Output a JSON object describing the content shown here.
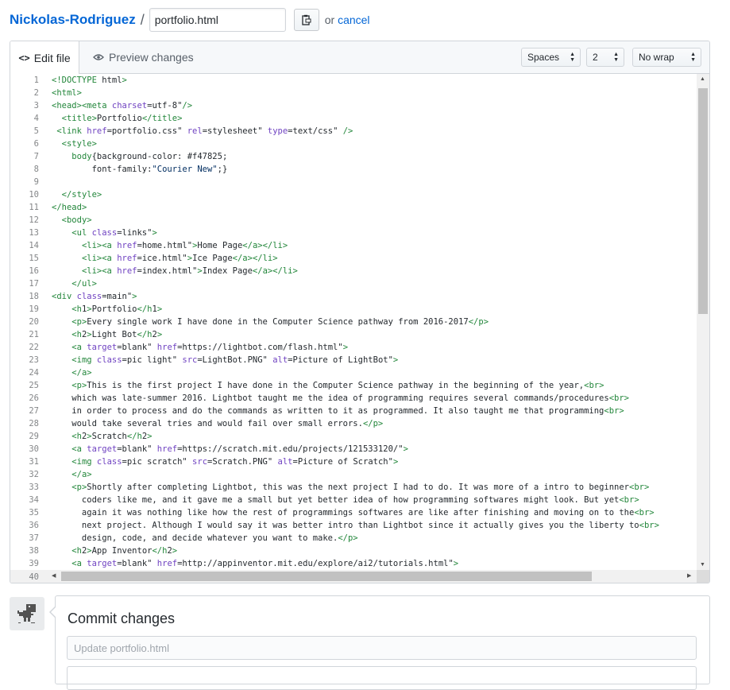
{
  "header": {
    "owner": "Nickolas-Rodriguez",
    "separator": "/",
    "filename": "portfolio.html",
    "or_text": "or",
    "cancel_label": "cancel"
  },
  "tabs": {
    "edit_label": "Edit file",
    "preview_label": "Preview changes"
  },
  "options": {
    "indent_mode": "Spaces",
    "indent_size": "2",
    "wrap_mode": "No wrap"
  },
  "code_lines": [
    "<!DOCTYPE html>",
    "<html>",
    "<head><meta charset=\"utf-8\"/>",
    "  <title>Portfolio</title>",
    " <link href=\"portfolio.css\" rel=\"stylesheet\" type=\"text/css\" />",
    "  <style>",
    "    body{background-color: #f47825;",
    "        font-family:\"Courier New\";}",
    "",
    "  </style>",
    "</head>",
    "  <body>",
    "    <ul class=\"links\">",
    "      <li><a href=\"home.html\">Home Page</a></li>",
    "      <li><a href=\"ice.html\">Ice Page</a></li>",
    "      <li><a href=\"index.html\">Index Page</a></li>",
    "    </ul>",
    "<div class=\"main\">",
    "    <h1>Portfolio</h1>",
    "    <p>Every single work I have done in the Computer Science pathway from 2016-2017</p>",
    "    <h2>Light Bot</h2>",
    "    <a target=\"blank\" href=\"https://lightbot.com/flash.html\">",
    "    <img class=\"pic light\" src=\"LightBot.PNG\" alt=\"Picture of LightBot\">",
    "    </a>",
    "    <p>This is the first project I have done in the Computer Science pathway in the beginning of the year,<br>",
    "    which was late-summer 2016. Lightbot taught me the idea of programming requires several commands/procedures<br>",
    "    in order to process and do the commands as written to it as programmed. It also taught me that programming<br>",
    "    would take several tries and would fail over small errors.</p>",
    "    <h2>Scratch</h2>",
    "    <a target=\"blank\" href=\"https://scratch.mit.edu/projects/121533120/\">",
    "    <img class=\"pic scratch\" src=\"Scratch.PNG\" alt=\"Picture of Scratch\">",
    "    </a>",
    "    <p>Shortly after completing Lightbot, this was the next project I had to do. It was more of a intro to beginner<br>",
    "      coders like me, and it gave me a small but yet better idea of how programming softwares might look. But yet<br>",
    "      again it was nothing like how the rest of programmings softwares are like after finishing and moving on to the<br>",
    "      next project. Although I would say it was better intro than Lightbot since it actually gives you the liberty to<br>",
    "      design, code, and decide whatever you want to make.</p>",
    "    <h2>App Inventor</h2>",
    "    <a target=\"blank\" href=\"http://appinventor.mit.edu/explore/ai2/tutorials.html\">"
  ],
  "last_line_number": "40",
  "commit": {
    "title": "Commit changes",
    "placeholder": "Update portfolio.html"
  }
}
